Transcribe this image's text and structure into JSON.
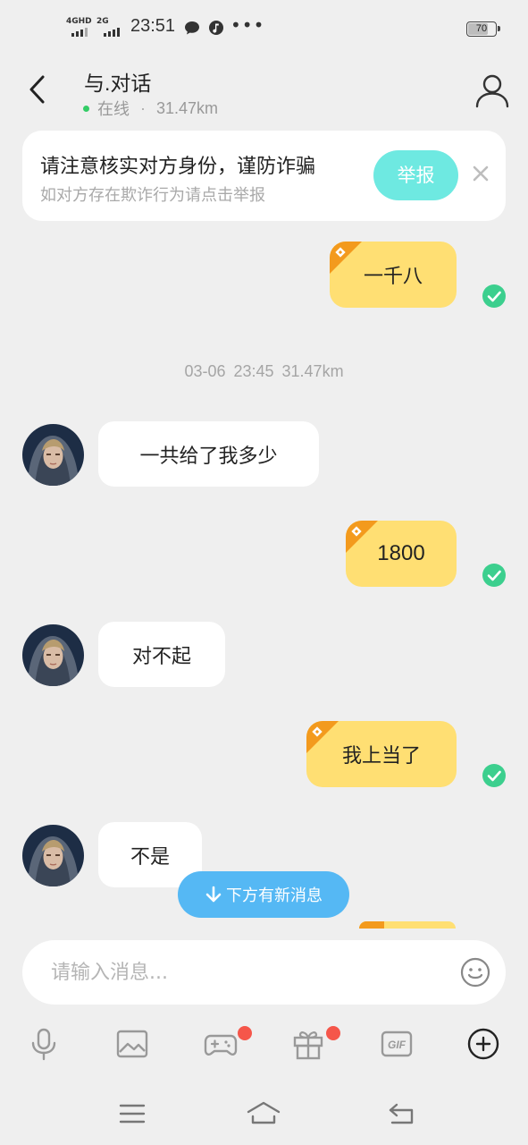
{
  "status_bar": {
    "network_4g": "4GHD",
    "network_2g": "2G",
    "time": "23:51",
    "more": "•••",
    "battery": "70"
  },
  "header": {
    "title": "与.对话",
    "status": "在线",
    "distance": "31.47km"
  },
  "warning": {
    "title": "请注意核实对方身份，谨防诈骗",
    "subtitle": "如对方存在欺诈行为请点击举报",
    "report_label": "举报"
  },
  "messages": [
    {
      "from": "me",
      "text": "一千八",
      "read": true
    },
    {
      "from": "them",
      "text": "一共给了我多少"
    },
    {
      "from": "me",
      "text": "1800",
      "read": true
    },
    {
      "from": "them",
      "text": "对不起"
    },
    {
      "from": "me",
      "text": "我上当了",
      "read": true
    },
    {
      "from": "them",
      "text": "不是"
    }
  ],
  "timestamp": "03-06 23:45  31.47km",
  "new_message_hint": "下方有新消息",
  "input": {
    "placeholder": "请输入消息..."
  },
  "toolbar": {
    "items": [
      "microphone-icon",
      "image-icon",
      "game-icon",
      "gift-icon",
      "gif-icon",
      "plus-icon"
    ],
    "badges": [
      "game",
      "gift"
    ],
    "gif_label": "GIF"
  },
  "colors": {
    "my_bubble": "#ffdf73",
    "bubble_corner": "#f39a1d",
    "report_button": "#6ee9e1",
    "read_check": "#3ccf8e",
    "new_msg_pill": "#55b8f4",
    "badge": "#f5564a",
    "online": "#33cc66"
  }
}
